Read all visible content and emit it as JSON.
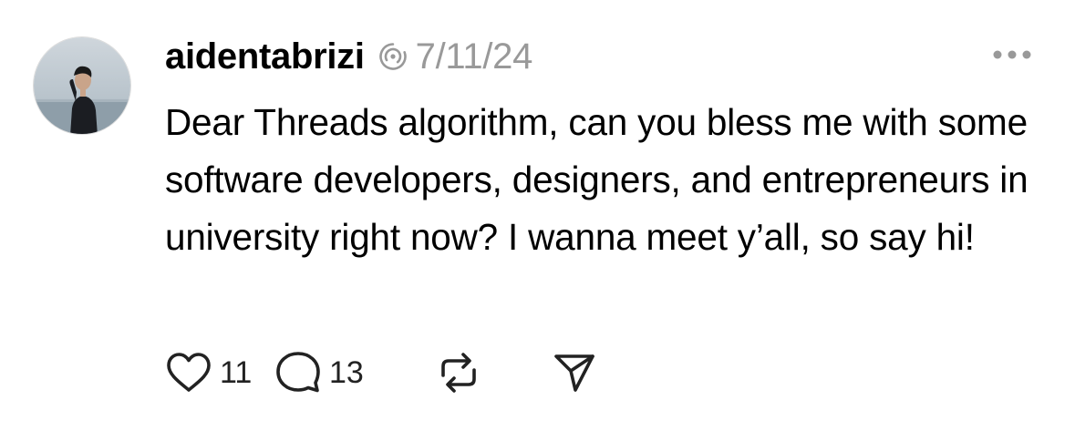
{
  "post": {
    "username": "aidentabrizi",
    "date": "7/11/24",
    "text": "Dear Threads algorithm, can you bless me with some software developers, designers, and entrepreneurs in university right now? I wanna meet y’all, so say hi!",
    "likes": "11",
    "replies": "13"
  },
  "icons": {
    "avatar": "profile-photo",
    "badge": "threads-spiral-icon",
    "more": "more-horizontal-icon",
    "like": "heart-icon",
    "reply": "comment-bubble-icon",
    "repost": "repost-icon",
    "share": "send-icon"
  },
  "colors": {
    "text": "#000000",
    "muted": "#999999",
    "icon": "#222222"
  }
}
